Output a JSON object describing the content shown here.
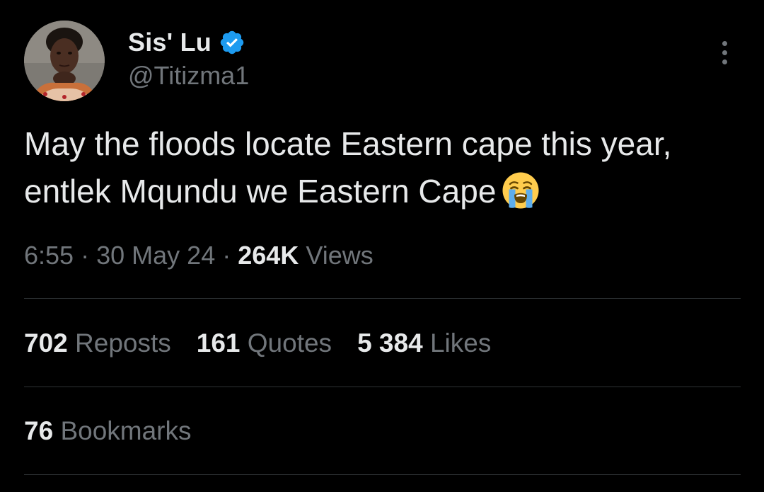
{
  "author": {
    "display_name": "Sis' Lu",
    "handle": "@Titizma1",
    "verified": true,
    "avatar_icon": "profile-photo",
    "verified_icon": "verified-badge-icon"
  },
  "tweet": {
    "text": "May the floods locate Eastern cape this year, entlek Mqundu we Eastern Cape",
    "emoji_icon": "loudly-crying-face-emoji"
  },
  "meta": {
    "time": "6:55",
    "separator": "·",
    "date": "30 May 24",
    "views_count": "264K",
    "views_label": "Views"
  },
  "stats": {
    "reposts_count": "702",
    "reposts_label": "Reposts",
    "quotes_count": "161",
    "quotes_label": "Quotes",
    "likes_count": "5 384",
    "likes_label": "Likes",
    "bookmarks_count": "76",
    "bookmarks_label": "Bookmarks"
  },
  "colors": {
    "background": "#000000",
    "primary_text": "#e7e9ea",
    "secondary_text": "#71767b",
    "divider": "#2f3336",
    "verified_blue": "#1d9bf0"
  }
}
